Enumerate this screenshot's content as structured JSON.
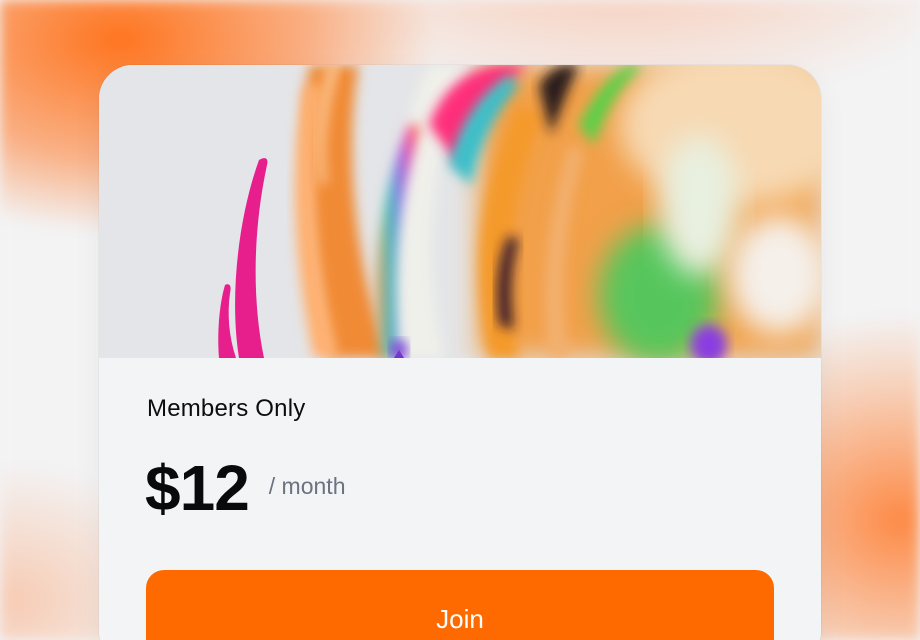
{
  "plan": {
    "title": "Members Only",
    "price": "$12",
    "period": "/ month",
    "cta_label": "Join"
  },
  "colors": {
    "accent": "#ff6a00",
    "card_background": "#f3f4f6",
    "period_text": "#6b7280"
  }
}
